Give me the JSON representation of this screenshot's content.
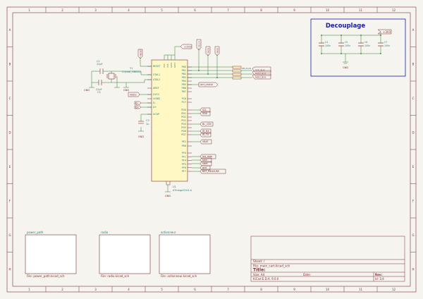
{
  "frame": {
    "col_labels": [
      "1",
      "2",
      "3",
      "4",
      "5",
      "6",
      "7",
      "8",
      "9",
      "10",
      "11",
      "12"
    ],
    "row_labels": [
      "A",
      "B",
      "C",
      "D",
      "E",
      "F",
      "G",
      "H"
    ]
  },
  "decoupling": {
    "title": "Decouplage",
    "net": "+3V3",
    "gnd": "GND",
    "caps": [
      {
        "ref": "C4",
        "val": "100n"
      },
      {
        "ref": "C5",
        "val": "100n"
      },
      {
        "ref": "C6",
        "val": "100n"
      },
      {
        "ref": "C7",
        "val": "100n"
      }
    ]
  },
  "mcu": {
    "ref": "U1",
    "value": "ATmega32U4-A",
    "top_net": "+3V3",
    "gnd": "GND",
    "left_pins": [
      "RESET",
      "XTAL1",
      "XTAL2",
      "AREF",
      "UVCC",
      "UVBUS",
      "D-",
      "D+",
      "UGND",
      "UCAP"
    ],
    "right_pins": [
      "PB0",
      "PB1",
      "PB2",
      "PB3",
      "PB4",
      "PB5",
      "PB6",
      "PB7",
      "PC6",
      "PC7",
      "PD0",
      "PD1",
      "PD2",
      "PD3",
      "PD4",
      "PD5",
      "PD6",
      "PD7",
      "PE2",
      "PE6",
      "PF0",
      "PF1",
      "PF4",
      "PF5",
      "PF6",
      "PF7"
    ],
    "top_pins": [
      "VCC",
      "VCC",
      "AVCC",
      "AVCC"
    ],
    "bottom_pins": [
      "GND",
      "GND"
    ]
  },
  "crystal": {
    "ref": "Y1",
    "value": "Crystal_GND24",
    "c1_ref": "C1",
    "c1_val": "22pF",
    "c2_ref": "C2",
    "c2_val": "22pF",
    "gnd": "GND"
  },
  "ucap": {
    "ref": "C3",
    "val": "1u",
    "gnd": "GND"
  },
  "labels": {
    "reset": "RESET",
    "vbus": "VBUS",
    "dminus": "D-",
    "dplus": "D+",
    "sd_cs": "SD_CS",
    "sd_card_cs": "SD_CARD",
    "mosi": "MOSI",
    "miso": "MISO",
    "sck": "SCK",
    "sck_bus": "SCK_BUS",
    "mosi_bus": "MOSI_BUS",
    "miso_bus": "MISO_BUS",
    "res_plan": "RES_PLAN",
    "arm_motor": "arm_motor",
    "scl": "SCL",
    "sda": "SDA",
    "bl_csn": "BL_CSN",
    "ir_rx": "IR_RX",
    "ir_tx": "IR_TX",
    "vbat": "VBAT",
    "led_data": "led_data",
    "serv": "serv",
    "start": "start",
    "gnd_net": "gnd",
    "bat_measure": "BAT_MEASURE"
  },
  "sheets": [
    {
      "name": "power_path",
      "file": "File: power_path.kicad_sch"
    },
    {
      "name": "radio",
      "file": "File: radio.kicad_sch"
    },
    {
      "name": "actionneur",
      "file": "File: actionneur.kicad_sch"
    }
  ],
  "title_block": {
    "sheet": "Sheet: /",
    "file": "File: main_cart.kicad_sch",
    "title": "Title:",
    "size": "Size: A4",
    "date": "Date:",
    "rev": "Rev:",
    "kicad": "KiCad E.D.A. 9.0.0",
    "id": "Id: 1/4"
  }
}
